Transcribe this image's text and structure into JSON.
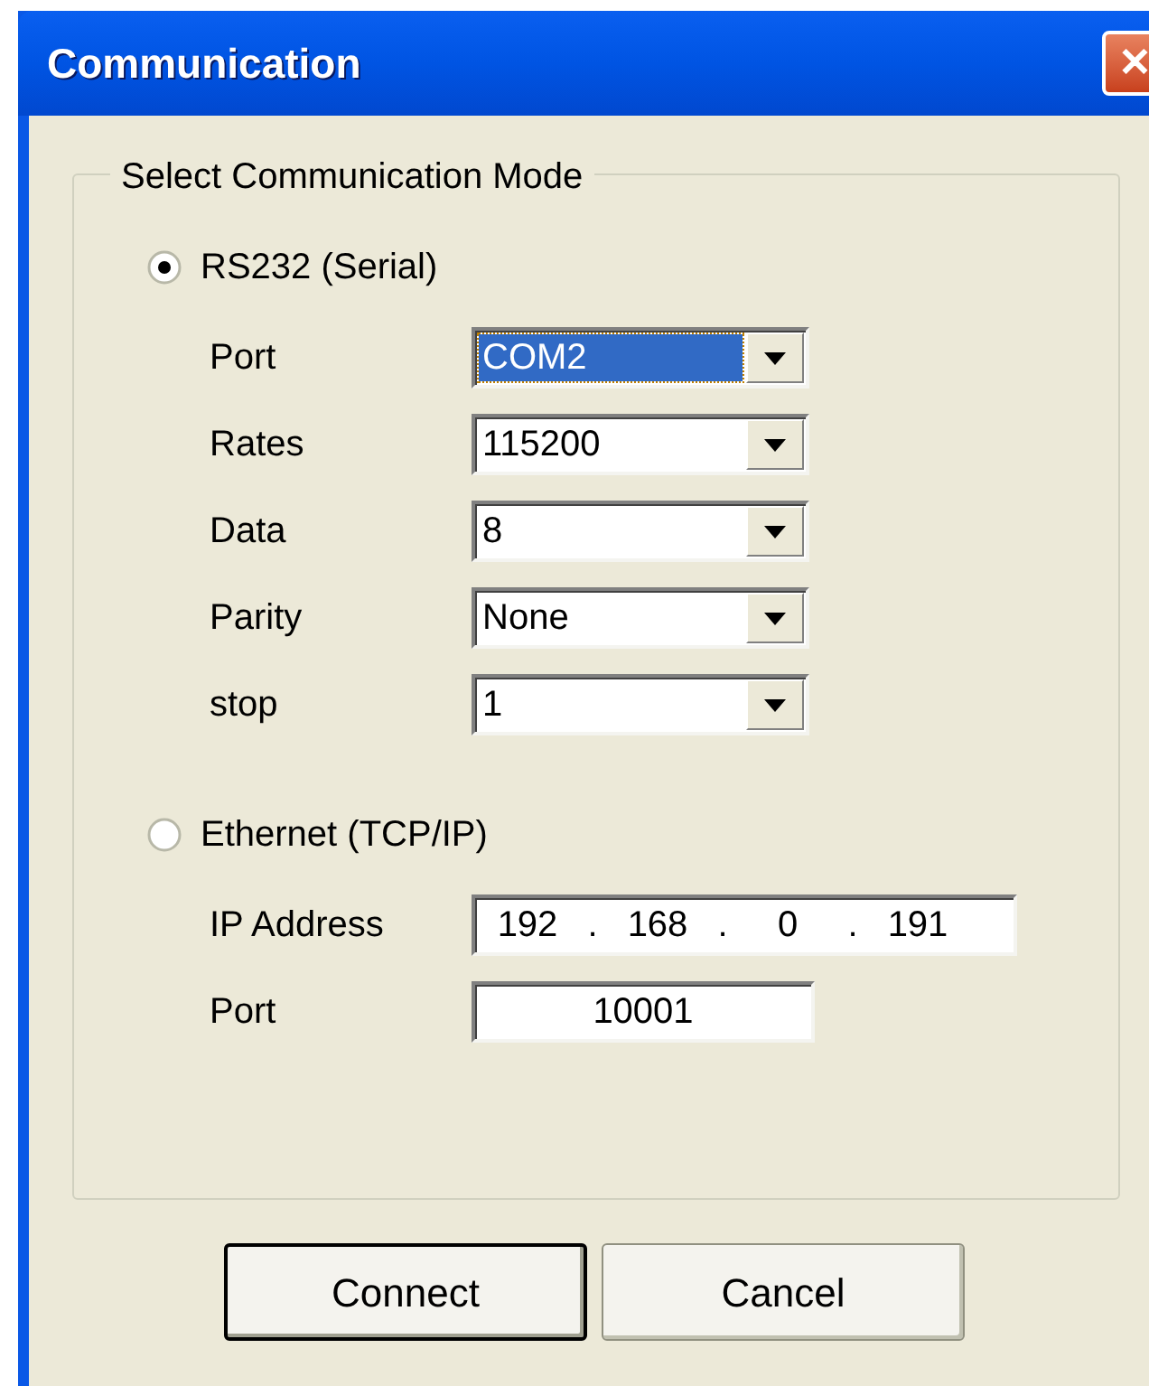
{
  "window": {
    "title": "Communication",
    "close_label": "✕"
  },
  "group": {
    "title": "Select Communication Mode"
  },
  "modes": [
    {
      "label": "RS232 (Serial)",
      "selected": true,
      "fields": [
        {
          "kind": "dropdown",
          "label": "Port",
          "value": "COM2",
          "focused": true
        },
        {
          "kind": "dropdown",
          "label": "Rates",
          "value": "115200",
          "focused": false
        },
        {
          "kind": "dropdown",
          "label": "Data",
          "value": "8",
          "focused": false
        },
        {
          "kind": "dropdown",
          "label": "Parity",
          "value": "None",
          "focused": false
        },
        {
          "kind": "dropdown",
          "label": "stop",
          "value": "1",
          "focused": false
        }
      ]
    },
    {
      "label": "Ethernet (TCP/IP)",
      "selected": false,
      "fields": [
        {
          "kind": "ip",
          "label": "IP Address",
          "octets": [
            "192",
            "168",
            "0",
            "191"
          ],
          "separator": "."
        },
        {
          "kind": "text",
          "label": "Port",
          "value": "10001"
        }
      ]
    }
  ],
  "buttons": [
    {
      "label": "Connect",
      "default": true
    },
    {
      "label": "Cancel",
      "default": false
    }
  ]
}
